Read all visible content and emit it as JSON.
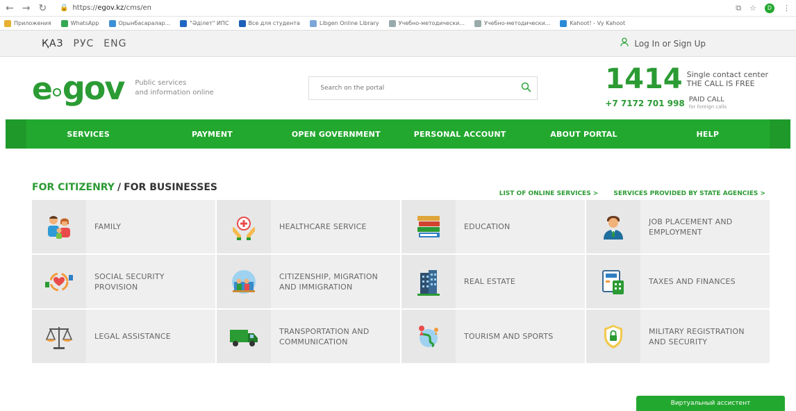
{
  "browser": {
    "url_prefix": "https://",
    "url_host": "egov.kz",
    "url_path": "/cms/en"
  },
  "bookmarks": [
    {
      "label": "Приложения",
      "color": "#e8b030"
    },
    {
      "label": "WhatsApp",
      "color": "#34a853"
    },
    {
      "label": "Орынбасаралар...",
      "color": "#3c8fd6"
    },
    {
      "label": "\"Әділет\" ИПС",
      "color": "#2066c2"
    },
    {
      "label": "Все для студента",
      "color": "#1c5fb8"
    },
    {
      "label": "Libgen Online Library",
      "color": "#7da6d8"
    },
    {
      "label": "Учебно-методически...",
      "color": "#9aa"
    },
    {
      "label": "Учебно-методически...",
      "color": "#9aa"
    },
    {
      "label": "Kahoot! - Vy Kahoot",
      "color": "#2b8ad6"
    }
  ],
  "languages": [
    "ҚАЗ",
    "РУС",
    "ENG"
  ],
  "login_label": "Log In or Sign Up",
  "logo": {
    "text_e": "e",
    "text_gov": "gov",
    "subtitle_1": "Public services",
    "subtitle_2": "and information online"
  },
  "search": {
    "placeholder": "Search on the portal"
  },
  "contact": {
    "number": "1414",
    "note_1": "Single contact center",
    "note_2": "THE CALL IS FREE",
    "phone": "+7 7172 701 998",
    "paid_label": "PAID CALL",
    "paid_note": "for foreign calls"
  },
  "menu": [
    "SERVICES",
    "PAYMENT",
    "OPEN GOVERNMENT",
    "PERSONAL ACCOUNT",
    "ABOUT PORTAL",
    "HELP"
  ],
  "section": {
    "title_citizen": "FOR CITIZENRY",
    "sep": "/",
    "title_business": "FOR BUSINESSES",
    "link_online": "LIST OF ONLINE SERVICES >",
    "link_agencies": "SERVICES PROVIDED BY STATE AGENCIES >"
  },
  "tiles": [
    {
      "label": "FAMILY",
      "icon": "family-icon"
    },
    {
      "label": "HEALTHCARE SERVICE",
      "icon": "healthcare-icon"
    },
    {
      "label": "EDUCATION",
      "icon": "books-icon"
    },
    {
      "label": "JOB PLACEMENT AND EMPLOYMENT",
      "icon": "worker-icon"
    },
    {
      "label": "SOCIAL SECURITY PROVISION",
      "icon": "social-icon"
    },
    {
      "label": "CITIZENSHIP, MIGRATION AND IMMIGRATION",
      "icon": "migration-icon"
    },
    {
      "label": "REAL ESTATE",
      "icon": "building-icon"
    },
    {
      "label": "TAXES AND FINANCES",
      "icon": "calculator-icon"
    },
    {
      "label": "LEGAL ASSISTANCE",
      "icon": "scales-icon"
    },
    {
      "label": "TRANSPORTATION AND COMMUNICATION",
      "icon": "truck-icon"
    },
    {
      "label": "TOURISM AND SPORTS",
      "icon": "globe-icon"
    },
    {
      "label": "MILITARY REGISTRATION AND SECURITY",
      "icon": "shield-icon"
    }
  ],
  "assistant_label": "Виртуальный ассистент"
}
